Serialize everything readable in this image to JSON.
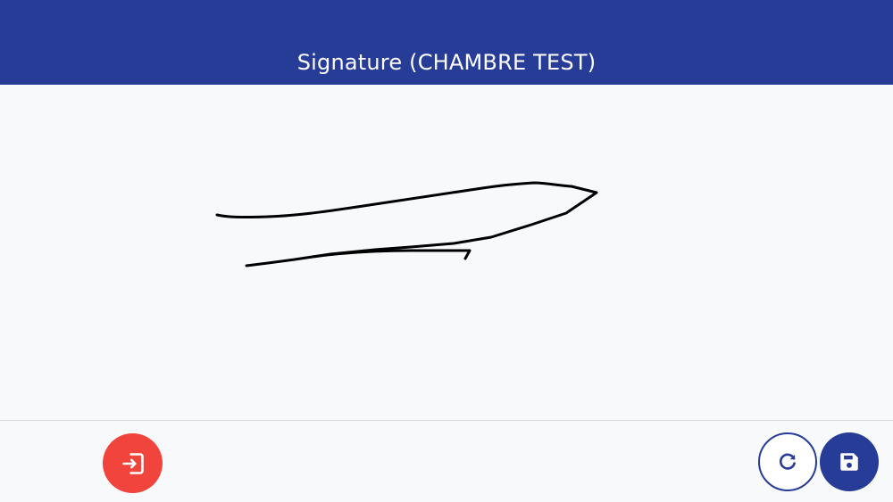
{
  "header": {
    "title": "Signature (CHAMBRE TEST)",
    "background_color": "#273c96"
  },
  "signature_pad": {
    "ink_color": "#000000",
    "background_color": "#f8f9fb"
  },
  "footer": {
    "exit_button": {
      "icon": "exit-icon",
      "color": "#f0443c"
    },
    "reset_button": {
      "icon": "refresh-icon",
      "color": "#273c96"
    },
    "save_button": {
      "icon": "save-icon",
      "color": "#273c96"
    }
  }
}
